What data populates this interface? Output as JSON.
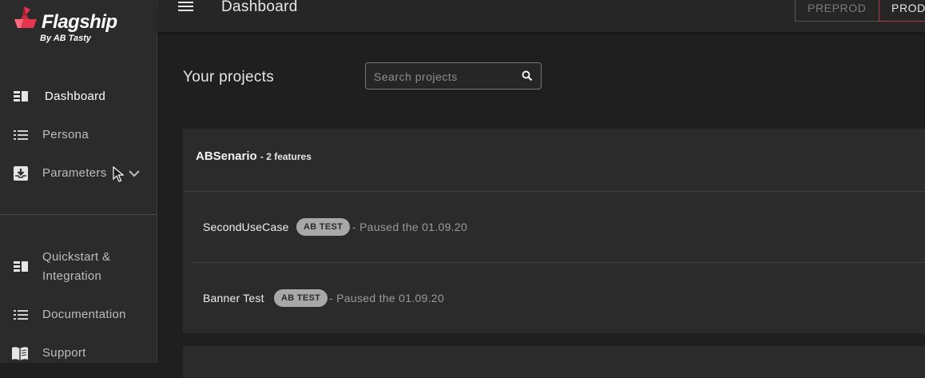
{
  "brand": {
    "name": "Flagship",
    "by": "By AB Tasty"
  },
  "nav": {
    "items": [
      {
        "label": "Dashboard",
        "icon": "dashboard-icon"
      },
      {
        "label": "Persona",
        "icon": "list-icon"
      },
      {
        "label": "Parameters",
        "icon": "inbox-download-icon"
      }
    ],
    "bottom_items": [
      {
        "label_line1": "Quickstart &",
        "label_line2": "Integration",
        "icon": "dashboard-icon"
      },
      {
        "label": "Documentation",
        "icon": "list-icon"
      },
      {
        "label": "Support",
        "icon": "book-icon"
      }
    ]
  },
  "header": {
    "title": "Dashboard",
    "env": {
      "preprod": "PREPROD",
      "prod": "PROD"
    }
  },
  "main": {
    "heading": "Your projects",
    "search": {
      "placeholder": "Search projects",
      "value": ""
    },
    "projects": [
      {
        "name": "ABSenario",
        "count": "- 2 features",
        "features": [
          {
            "name": "SecondUseCase",
            "badge": "AB TEST",
            "status": "- Paused the 01.09.20"
          },
          {
            "name": "Banner Test",
            "badge": "AB TEST",
            "status": "- Paused the 01.09.20"
          }
        ]
      }
    ]
  },
  "colors": {
    "background": "#1f1f1f",
    "sidebar": "#2b2b2b",
    "accent": "#e4344f",
    "badge": "#a8a8a8"
  }
}
